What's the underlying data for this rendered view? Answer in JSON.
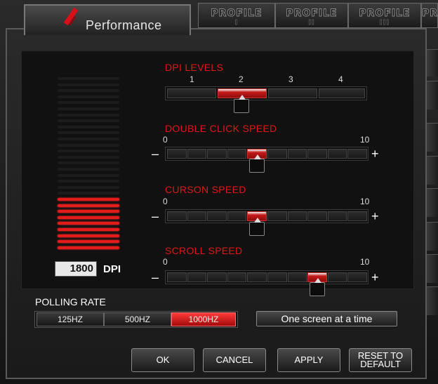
{
  "tabs": {
    "active": "Performance",
    "profiles": [
      {
        "label": "PROFILE",
        "number": "I"
      },
      {
        "label": "PROFILE",
        "number": "II"
      },
      {
        "label": "PROFILE",
        "number": "III"
      },
      {
        "label": "PR",
        "number": ""
      }
    ]
  },
  "dpi": {
    "title": "DPI LEVELS",
    "levels": [
      "1",
      "2",
      "3",
      "4"
    ],
    "selected_level": 2,
    "value": "1800",
    "unit": "DPI",
    "meter_total_bars": 29,
    "meter_active_bars": 9
  },
  "double_click": {
    "title": "DOUBLE CLICK SPEED",
    "min": "0",
    "max": "10",
    "value": 5,
    "minus": "–",
    "plus": "+"
  },
  "cursor": {
    "title": "CURSON SPEED",
    "min": "0",
    "max": "10",
    "value": 5,
    "minus": "–",
    "plus": "+"
  },
  "scroll": {
    "title": "SCROLL SPEED",
    "min": "0",
    "max": "10",
    "value": 8,
    "minus": "–",
    "plus": "+"
  },
  "polling": {
    "title": "POLLING RATE",
    "options": [
      "125HZ",
      "500HZ",
      "1000HZ"
    ],
    "selected": "1000HZ"
  },
  "scroll_mode_button": "One screen at a time",
  "actions": {
    "ok": "OK",
    "cancel": "CANCEL",
    "apply": "APPLY",
    "reset_line1": "RESET TO",
    "reset_line2": "DEFAULT"
  },
  "colors": {
    "accent": "#e01818",
    "active_bar": "#e41b1b"
  }
}
